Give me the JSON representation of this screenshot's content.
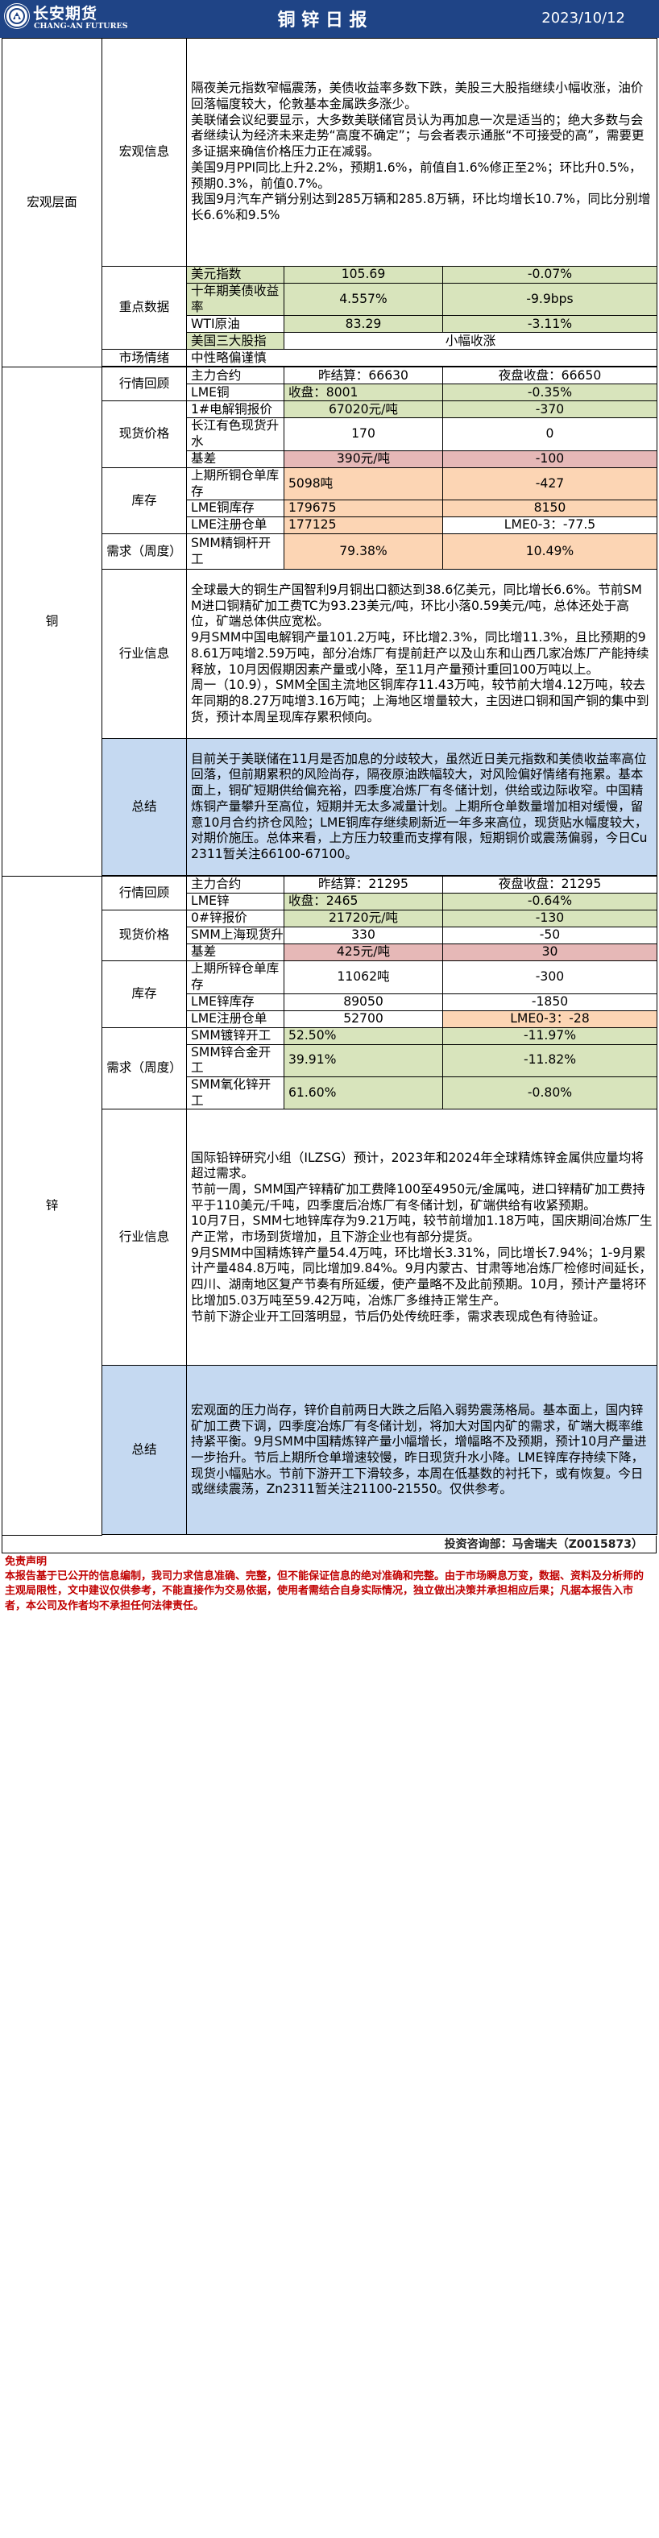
{
  "header": {
    "brand_cn": "长安期货",
    "brand_en": "CHANG-AN FUTURES",
    "title": "铜 锌 日 报",
    "date": "2023/10/12"
  },
  "macro": {
    "section": "宏观层面",
    "info_label": "宏观信息",
    "info_text": [
      "隔夜美元指数窄幅震荡，美债收益率多数下跌，美股三大股指继续小幅收涨，油价回落幅度较大，伦敦基本金属跌多涨少。",
      "美联储会议纪要显示，大多数美联储官员认为再加息一次是适当的；绝大多数与会者继续认为经济未来走势“高度不确定”；与会者表示通胀“不可接受的高”，需要更多证据来确信价格压力正在减弱。",
      "美国9月PPI同比上升2.2%，预期1.6%，前值自1.6%修正至2%；环比升0.5%，预期0.3%，前值0.7%。",
      "我国9月汽车产销分别达到285万辆和285.8万辆，环比均增长10.7%，同比分别增长6.6%和9.5%"
    ],
    "key_label": "重点数据",
    "key_rows": [
      {
        "name": "美元指数",
        "value": "105.69",
        "change": "-0.07%"
      },
      {
        "name": "十年期美债收益率",
        "value": "4.557%",
        "change": "-9.9bps"
      },
      {
        "name": "WTI原油",
        "value": "83.29",
        "change": "-3.11%"
      },
      {
        "name": "美国三大股指",
        "value": "小幅收涨"
      }
    ],
    "sentiment_label": "市场情绪",
    "sentiment": "中性略偏谨慎"
  },
  "copper": {
    "section": "铜",
    "quote_label": "行情回顾",
    "main_contract": "主力合约",
    "settle": "昨结算：66630",
    "night_close": "夜盘收盘：66650",
    "lme_name": "LME铜",
    "lme_close": "收盘：8001",
    "lme_change": "-0.35%",
    "spot_label": "现货价格",
    "spot1_name": "1#电解铜报价",
    "spot1_value": "67020元/吨",
    "spot1_change": "-370",
    "spot2_name": "长江有色现货升水",
    "spot2_value": "170",
    "spot2_change": "0",
    "basis_name": "基差",
    "basis_value": "390元/吨",
    "basis_change": "-100",
    "stock_label": "库存",
    "stock1_name": "上期所铜仓单库存",
    "stock1_value": "5098吨",
    "stock1_change": "-427",
    "stock2_name": "LME铜库存",
    "stock2_value": "179675",
    "stock2_change": "8150",
    "stock3_name": "LME注册仓单",
    "stock3_value": "177125",
    "stock3_change": "LME0-3：-77.5",
    "demand_label": "需求（周度）",
    "demand1_name": "SMM精铜杆开工",
    "demand1_value": "79.38%",
    "demand1_change": "10.49%",
    "industry_label": "行业信息",
    "industry_text": [
      "全球最大的铜生产国智利9月铜出口额达到38.6亿美元，同比增长6.6%。节前SMM进口铜精矿加工费TC为93.23美元/吨，环比小落0.59美元/吨，总体还处于高位，矿端总体供应宽松。",
      "9月SMM中国电解铜产量101.2万吨，环比增2.3%，同比增11.3%，且比预期的98.61万吨增2.59万吨，部分冶炼厂有提前赶产以及山东和山西几家冶炼厂产能持续释放，10月因假期因素产量或小降，至11月产量预计重回100万吨以上。",
      "周一（10.9），SMM全国主流地区铜库存11.43万吨，较节前大增4.12万吨，较去年同期的8.27万吨增3.16万吨；上海地区增量较大，主因进口铜和国产铜的集中到货，预计本周呈现库存累积倾向。"
    ],
    "summary_label": "总结",
    "summary": "目前关于美联储在11月是否加息的分歧较大，虽然近日美元指数和美债收益率高位回落，但前期累积的风险尚存，隔夜原油跌幅较大，对风险偏好情绪有拖累。基本面上，铜矿短期供给偏充裕，四季度冶炼厂有冬储计划，供给或边际收窄。中国精炼铜产量攀升至高位，短期并无太多减量计划。上期所仓单数量增加相对缓慢，留意10月合约挤仓风险；LME铜库存继续刷新近一年多来高位，现货贴水幅度较大，对期价施压。总体来看，上方压力较重而支撑有限，短期铜价或震荡偏弱，今日Cu2311暂关注66100-67100。"
  },
  "zinc": {
    "section": "锌",
    "quote_label": "行情回顾",
    "main_contract": "主力合约",
    "settle": "昨结算：21295",
    "night_close": "夜盘收盘：21295",
    "lme_name": "LME锌",
    "lme_close": "收盘：2465",
    "lme_change": "-0.64%",
    "spot_label": "现货价格",
    "spot1_name": "0#锌报价",
    "spot1_value": "21720元/吨",
    "spot1_change": "-130",
    "spot2_name": "SMM上海现货升水",
    "spot2_value": "330",
    "spot2_change": "-50",
    "basis_name": "基差",
    "basis_value": "425元/吨",
    "basis_change": "30",
    "stock_label": "库存",
    "stock1_name": "上期所锌仓单库存",
    "stock1_value": "11062吨",
    "stock1_change": "-300",
    "stock2_name": "LME锌库存",
    "stock2_value": "89050",
    "stock2_change": "-1850",
    "stock3_name": "LME注册仓单",
    "stock3_value": "52700",
    "stock3_change": "LME0-3：-28",
    "demand_label": "需求（周度）",
    "demand1_name": "SMM镀锌开工",
    "demand1_value": "52.50%",
    "demand1_change": "-11.97%",
    "demand2_name": "SMM锌合金开工",
    "demand2_value": "39.91%",
    "demand2_change": "-11.82%",
    "demand3_name": "SMM氧化锌开工",
    "demand3_value": "61.60%",
    "demand3_change": "-0.80%",
    "industry_label": "行业信息",
    "industry_text": [
      "国际铅锌研究小组（ILZSG）预计，2023年和2024年全球精炼锌金属供应量均将超过需求。",
      "节前一周，SMM国产锌精矿加工费降100至4950元/金属吨，进口锌精矿加工费持平于110美元/千吨，四季度后冶炼厂有冬储计划，矿端供给有收紧预期。",
      "10月7日，SMM七地锌库存为9.21万吨，较节前增加1.18万吨，国庆期间冶炼厂生产正常，市场到货增加，且下游企业也有部分提货。",
      "9月SMM中国精炼锌产量54.4万吨，环比增长3.31%，同比增长7.94%；1-9月累计产量484.8万吨，同比增加9.84%。9月内蒙古、甘肃等地冶炼厂检修时间延长，四川、湖南地区复产节奏有所延缓，使产量略不及此前预期。10月，预计产量将环比增加5.03万吨至59.42万吨，冶炼厂多维持正常生产。",
      "节前下游企业开工回落明显，节后仍处传统旺季，需求表现成色有待验证。"
    ],
    "summary_label": "总结",
    "summary": "宏观面的压力尚存，锌价自前两日大跌之后陷入弱势震荡格局。基本面上，国内锌矿加工费下调，四季度冶炼厂有冬储计划，将加大对国内矿的需求，矿端大概率维持紧平衡。9月SMM中国精炼锌产量小幅增长，增幅略不及预期，预计10月产量进一步抬升。节后上期所仓单增速较慢，昨日现货升水小降。LME锌库存持续下降，现货小幅贴水。节前下游开工下滑较多，本周在低基数的衬托下，或有恢复。今日或继续震荡，Zn2311暂关注21100-21550。仅供参考。"
  },
  "footer": {
    "analyst": "投资咨询部：马舍瑞夫（Z0015873）",
    "disclaimer_title": "免责声明",
    "disclaimer": "本报告基于已公开的信息编制，我司力求信息准确、完整，但不能保证信息的绝对准确和完整。由于市场瞬息万变，数据、资料及分析师的主观局限性，文中建议仅供参考，不能直接作为交易依据，使用者需结合自身实际情况，独立做出决策并承担相应后果；凡据本报告入市者，本公司及作者均不承担任何法律责任。"
  }
}
